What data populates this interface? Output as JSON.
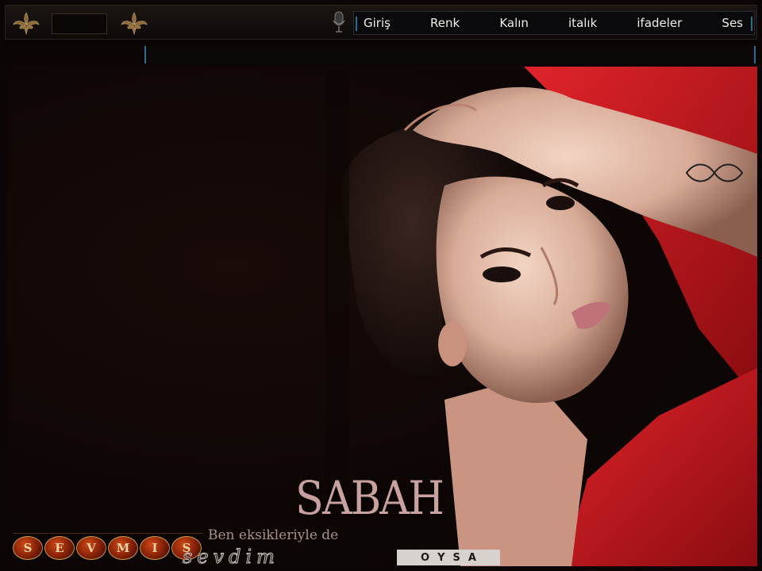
{
  "menu": {
    "items": [
      "Giriş",
      "Renk",
      "Kalın",
      "italık",
      "ifadeler",
      "Ses"
    ]
  },
  "icons": {
    "fleur_left": "fleur-de-lis-icon",
    "fleur_right": "fleur-de-lis-icon",
    "mic": "microphone-icon"
  },
  "artwork": {
    "title": "SABAH",
    "caption": "Ben eksikleriyle de",
    "script": "sevdim",
    "oysa_letters": [
      "O",
      "Y",
      "S",
      "A"
    ],
    "bead_letters": [
      "S",
      "E",
      "V",
      "M",
      "I",
      "Ş"
    ]
  },
  "colors": {
    "accent_blue": "#2f6b8a",
    "dress_red": "#c8151b",
    "gold": "#c99b45"
  }
}
